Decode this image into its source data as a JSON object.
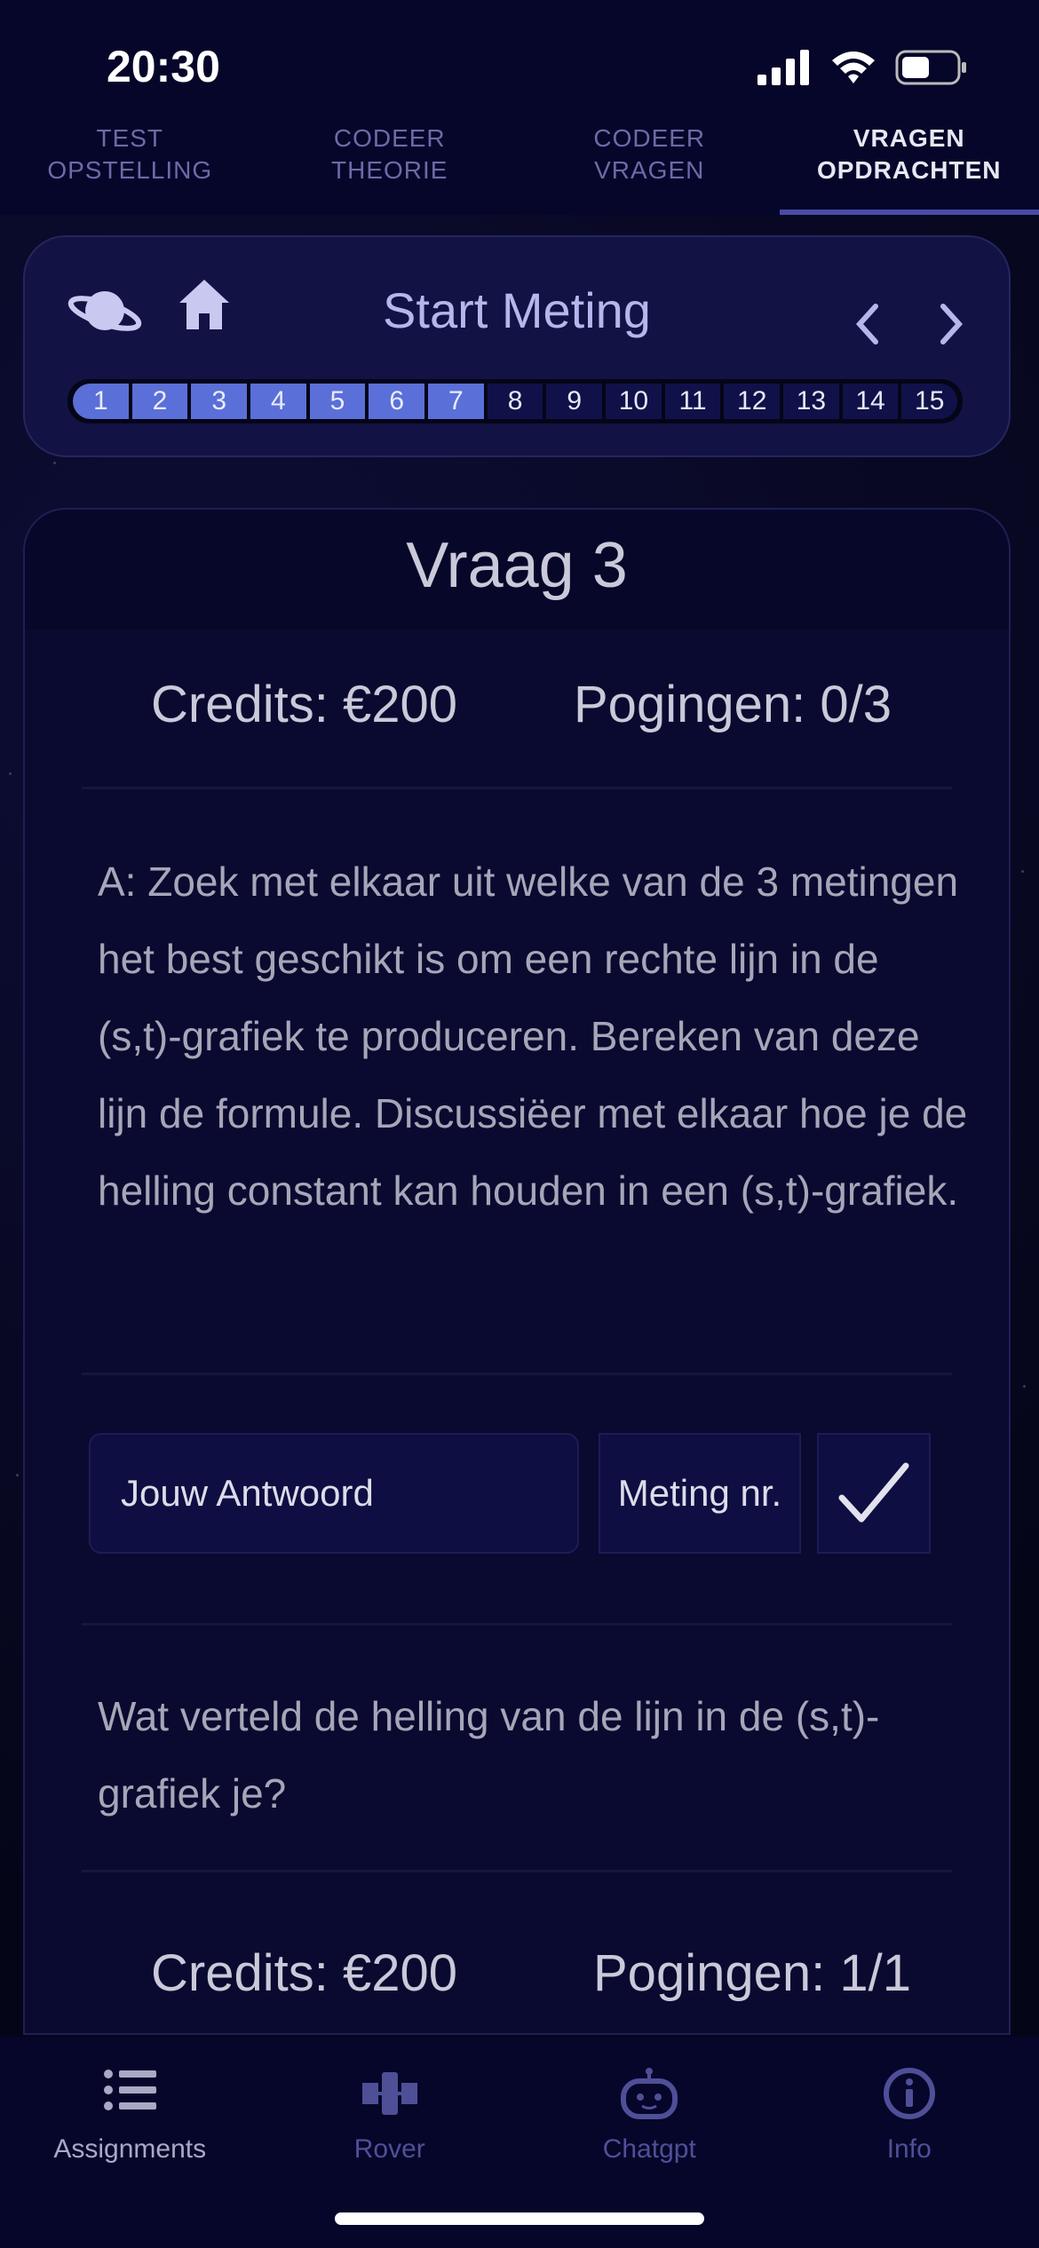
{
  "status": {
    "time": "20:30"
  },
  "tabs": [
    {
      "line1": "TEST",
      "line2": "OPSTELLING"
    },
    {
      "line1": "CODEER",
      "line2": "THEORIE"
    },
    {
      "line1": "CODEER",
      "line2": "VRAGEN"
    },
    {
      "line1": "VRAGEN",
      "line2": "OPDRACHTEN"
    }
  ],
  "header": {
    "title": "Start Meting",
    "steps": [
      "1",
      "2",
      "3",
      "4",
      "5",
      "6",
      "7",
      "8",
      "9",
      "10",
      "11",
      "12",
      "13",
      "14",
      "15"
    ],
    "completed_steps": 7
  },
  "question": {
    "title": "Vraag 3",
    "credits": "Credits: €200",
    "attempts": "Pogingen: 0/3",
    "body": "A: Zoek met elkaar uit welke van de 3 metingen het best geschikt is om een rechte lijn in de (s,t)-grafiek te produceren. Bereken van deze lijn de formule. Discussiëer met elkaar hoe je de helling constant kan houden in een (s,t)-grafiek.",
    "answer_placeholder": "Jouw Antwoord",
    "meting_label": "Meting nr.",
    "second_question": "Wat verteld de helling van de lijn in de (s,t)-grafiek je?",
    "credits2": "Credits: €200",
    "attempts2": "Pogingen: 1/1"
  },
  "bottom_nav": [
    {
      "label": "Assignments",
      "icon": "list-icon"
    },
    {
      "label": "Rover",
      "icon": "satellite-icon"
    },
    {
      "label": "Chatgpt",
      "icon": "robot-icon"
    },
    {
      "label": "Info",
      "icon": "info-icon"
    }
  ],
  "colors": {
    "accent": "#5b6fd8",
    "background": "#07072a",
    "card": "#121244"
  }
}
